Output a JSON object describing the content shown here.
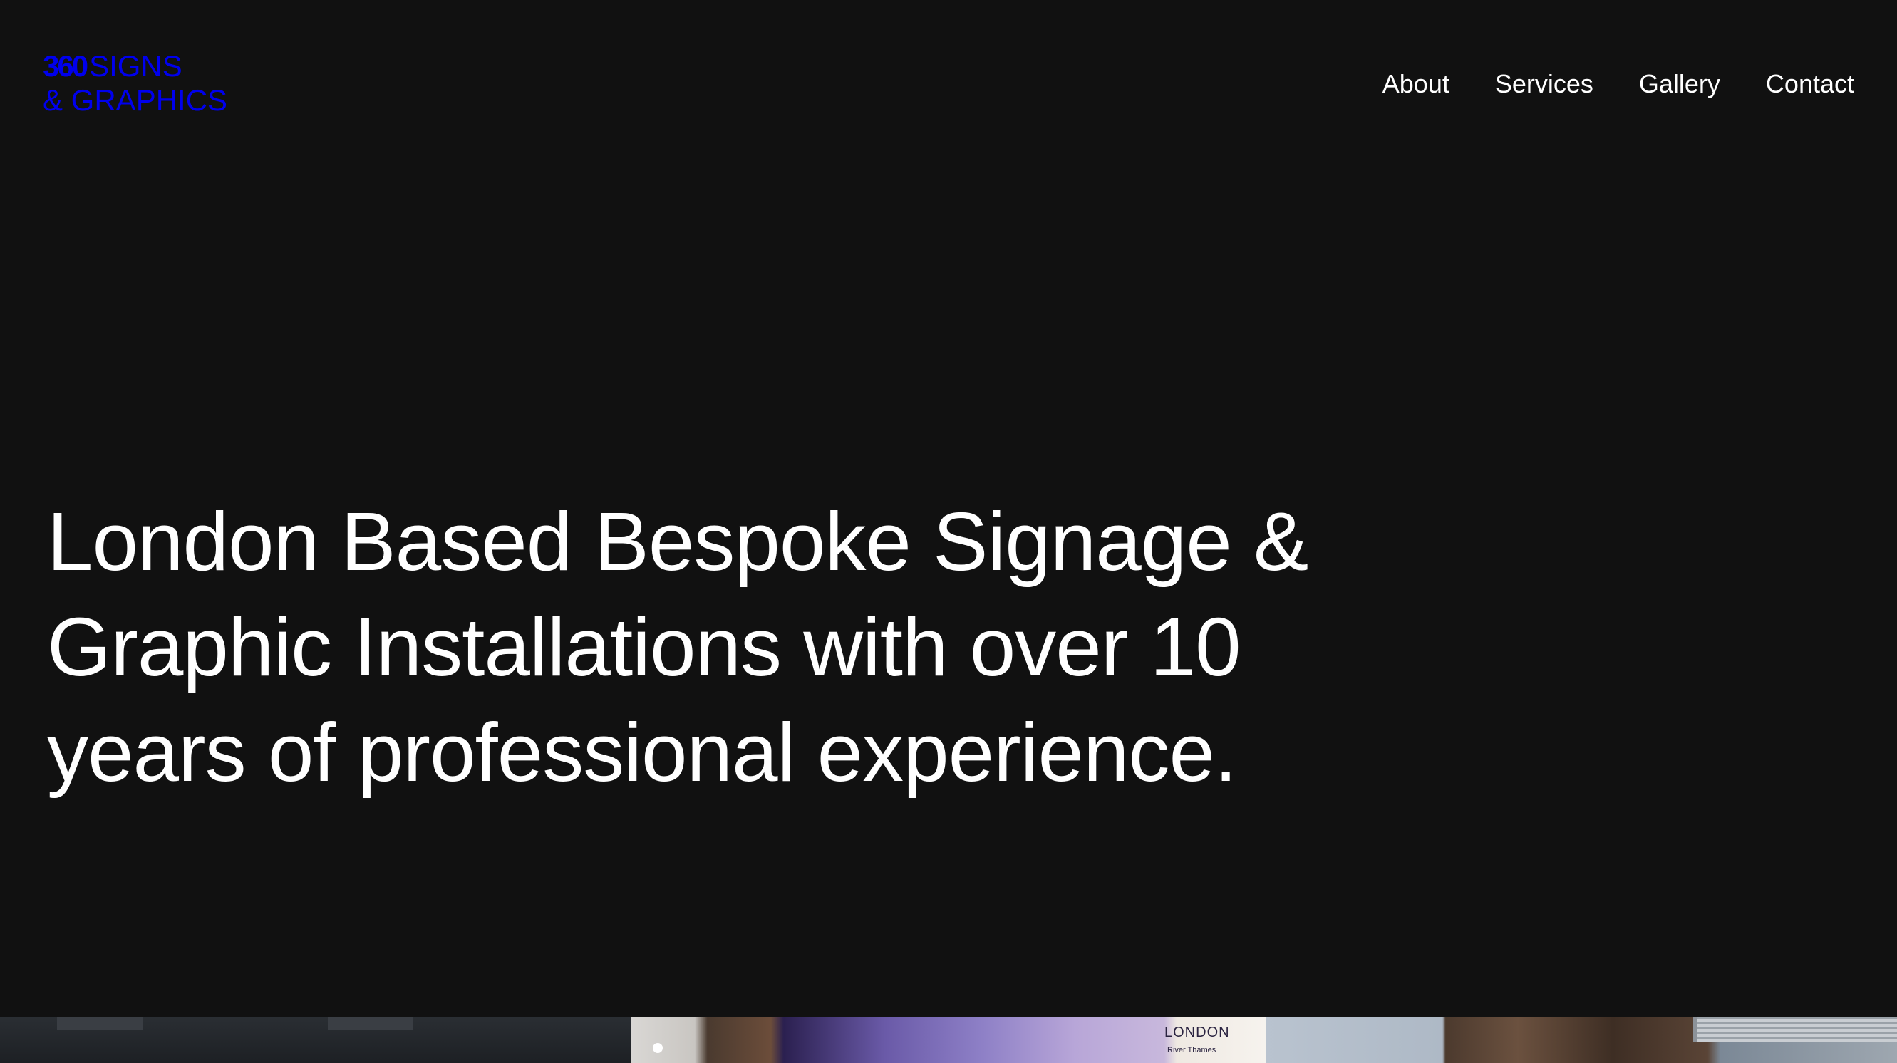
{
  "brand": {
    "logo_number": "360",
    "logo_word": "SIGNS",
    "logo_line2": "& GRAPHICS"
  },
  "nav": {
    "items": [
      {
        "label": "About"
      },
      {
        "label": "Services"
      },
      {
        "label": "Gallery"
      },
      {
        "label": "Contact"
      }
    ]
  },
  "hero": {
    "lines": [
      "London Based Bespoke Signage &",
      "Graphic Installations with over 10",
      "years of professional experience."
    ]
  },
  "gallery": {
    "tiles": [
      {
        "icon": "photo"
      },
      {
        "icon": "photo",
        "map_label": "LONDON",
        "map_sublabel": "River Thames"
      },
      {
        "icon": "photo"
      }
    ]
  },
  "colors": {
    "background": "#111111",
    "text": "#ffffff"
  }
}
